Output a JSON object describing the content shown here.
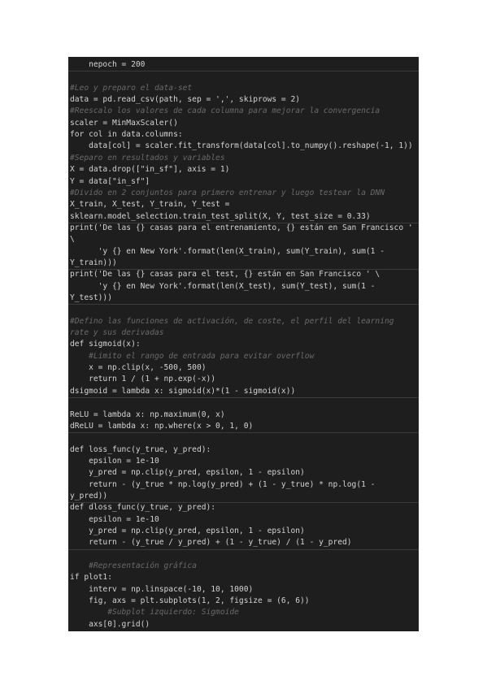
{
  "code_lines": [
    {
      "text": "    nepoch = 200",
      "comment": false
    },
    {
      "text": "",
      "comment": false
    },
    {
      "text": "#Leo y preparo el data-set",
      "comment": true
    },
    {
      "text": "data = pd.read_csv(path, sep = ',', skiprows = 2)",
      "comment": false
    },
    {
      "text": "#Reescalo los valores de cada columna para mejorar la convergencia",
      "comment": true
    },
    {
      "text": "scaler = MinMaxScaler()",
      "comment": false
    },
    {
      "text": "for col in data.columns:",
      "comment": false
    },
    {
      "text": "    data[col] = scaler.fit_transform(data[col].to_numpy().reshape(-1, 1))",
      "comment": false
    },
    {
      "text": "#Separo en resultados y variables",
      "comment": true
    },
    {
      "text": "X = data.drop([\"in_sf\"], axis = 1)",
      "comment": false
    },
    {
      "text": "Y = data[\"in_sf\"]",
      "comment": false
    },
    {
      "text": "#Divido en 2 conjuntos para primero entrenar y luego testear la DNN",
      "comment": true
    },
    {
      "text": "X_train, X_test, Y_train, Y_test =",
      "comment": false
    },
    {
      "text": "sklearn.model_selection.train_test_split(X, Y, test_size = 0.33)",
      "comment": false
    },
    {
      "text": "print('De las {} casas para el entrenamiento, {} están en San Francisco '",
      "comment": false
    },
    {
      "text": "\\",
      "comment": false
    },
    {
      "text": "      'y {} en New York'.format(len(X_train), sum(Y_train), sum(1 -",
      "comment": false
    },
    {
      "text": "Y_train)))",
      "comment": false
    },
    {
      "text": "print('De las {} casas para el test, {} están en San Francisco ' \\",
      "comment": false
    },
    {
      "text": "      'y {} en New York'.format(len(X_test), sum(Y_test), sum(1 -",
      "comment": false
    },
    {
      "text": "Y_test)))",
      "comment": false
    },
    {
      "text": "",
      "comment": false
    },
    {
      "text": "#Defino las funciones de activación, de coste, el perfil del learning",
      "comment": true
    },
    {
      "text": "rate y sus derivadas",
      "comment": true
    },
    {
      "text": "def sigmoid(x):",
      "comment": false
    },
    {
      "text": "    #Limito el rango de entrada para evitar overflow",
      "comment": true
    },
    {
      "text": "    x = np.clip(x, -500, 500)",
      "comment": false
    },
    {
      "text": "    return 1 / (1 + np.exp(-x))",
      "comment": false
    },
    {
      "text": "dsigmoid = lambda x: sigmoid(x)*(1 - sigmoid(x))",
      "comment": false
    },
    {
      "text": "",
      "comment": false
    },
    {
      "text": "ReLU = lambda x: np.maximum(0, x)",
      "comment": false
    },
    {
      "text": "dReLU = lambda x: np.where(x > 0, 1, 0)",
      "comment": false
    },
    {
      "text": "",
      "comment": false
    },
    {
      "text": "def loss_func(y_true, y_pred):",
      "comment": false
    },
    {
      "text": "    epsilon = 1e-10",
      "comment": false
    },
    {
      "text": "    y_pred = np.clip(y_pred, epsilon, 1 - epsilon)",
      "comment": false
    },
    {
      "text": "    return - (y_true * np.log(y_pred) + (1 - y_true) * np.log(1 -",
      "comment": false
    },
    {
      "text": "y_pred))",
      "comment": false
    },
    {
      "text": "def dloss_func(y_true, y_pred):",
      "comment": false
    },
    {
      "text": "    epsilon = 1e-10",
      "comment": false
    },
    {
      "text": "    y_pred = np.clip(y_pred, epsilon, 1 - epsilon)",
      "comment": false
    },
    {
      "text": "    return - (y_true / y_pred) + (1 - y_true) / (1 - y_pred)",
      "comment": false
    },
    {
      "text": "",
      "comment": false
    },
    {
      "text": "    #Representación gráfica",
      "comment": true
    },
    {
      "text": "if plot1:",
      "comment": false
    },
    {
      "text": "    interv = np.linspace(-10, 10, 1000)",
      "comment": false
    },
    {
      "text": "    fig, axs = plt.subplots(1, 2, figsize = (6, 6))",
      "comment": false
    },
    {
      "text": "        #Subplot izquierdo: Sigmoide",
      "comment": true
    },
    {
      "text": "    axs[0].grid()",
      "comment": false
    }
  ]
}
